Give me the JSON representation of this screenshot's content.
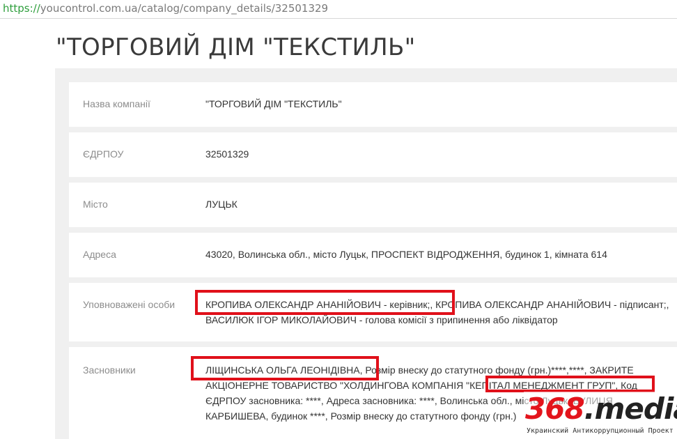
{
  "browser": {
    "url_scheme": "https://",
    "url_rest": "youcontrol.com.ua/catalog/company_details/32501329"
  },
  "page": {
    "title": "\"ТОРГОВИЙ ДІМ \"ТЕКСТИЛЬ\""
  },
  "company": {
    "rows": [
      {
        "label": "Назва компанії",
        "value": "\"ТОРГОВИЙ ДІМ \"ТЕКСТИЛЬ\""
      },
      {
        "label": "ЄДРПОУ",
        "value": "32501329"
      },
      {
        "label": "Місто",
        "value": "ЛУЦЬК"
      },
      {
        "label": "Адреса",
        "value": "43020, Волинська обл., місто Луцьк, ПРОСПЕКТ ВІДРОДЖЕННЯ, будинок 1, кімната 614"
      },
      {
        "label": "Уповноважені особи",
        "value": "КРОПИВА ОЛЕКСАНДР АНАНІЙОВИЧ - керівник;, КРОПИВА ОЛЕКСАНДР АНАНІЙОВИЧ - підписант;, ВАСИЛЮК ІГОР МИКОЛАЙОВИЧ - голова комісії з припинення або ліквідатор"
      },
      {
        "label": "Засновники",
        "value": "ЛІЩИНСЬКА ОЛЬГА ЛЕОНІДІВНА, Розмір внеску до статутного фонду (грн.)****,****, ЗАКРИТЕ АКЦІОНЕРНЕ ТОВАРИСТВО \"ХОЛДИНГОВА КОМПАНІЯ \"КЕПІТАЛ МЕНЕДЖМЕНТ ГРУП\", Код ЄДРПОУ засновника: ****, Адреса засновника: ****, Волинська обл., місто Луцьк, ВУЛИЦЯ КАРБИШЕВА, будинок ****, Розмір внеску до статутного фонду (грн.)"
      }
    ]
  },
  "watermark": {
    "number": "368",
    "name": ".media",
    "tagline": "Украинский Антикоррупционный Проект"
  },
  "colors": {
    "highlight": "#e0101a",
    "watermark_red": "#e3141c",
    "panel_bg": "#f0f0f0"
  }
}
